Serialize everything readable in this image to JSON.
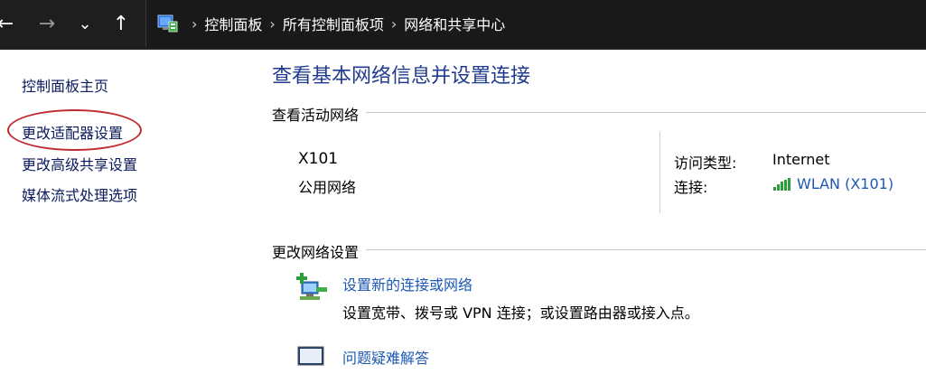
{
  "nav": {
    "back_glyph": "←",
    "forward_glyph": "→",
    "recent_glyph": "⌄",
    "up_glyph": "↑"
  },
  "address": {
    "icon": "control-panel-icon",
    "crumbs": [
      "控制面板",
      "所有控制面板项",
      "网络和共享中心"
    ],
    "separator": "›"
  },
  "sidebar": {
    "items": [
      "控制面板主页",
      "更改适配器设置",
      "更改高级共享设置",
      "媒体流式处理选项"
    ],
    "highlight_color": "#c22a30"
  },
  "main": {
    "title": "查看基本网络信息并设置连接",
    "active_section": "查看活动网络",
    "network": {
      "name": "X101",
      "type": "公用网络",
      "access_label": "访问类型:",
      "access_value": "Internet",
      "connection_label": "连接:",
      "connection_value": "WLAN (X101)",
      "connection_icon": "wifi-signal-icon"
    },
    "change_section": "更改网络设置",
    "tasks": [
      {
        "icon": "new-connection-icon",
        "title": "设置新的连接或网络",
        "desc": "设置宽带、拨号或 VPN 连接；或设置路由器或接入点。"
      },
      {
        "icon": "troubleshoot-icon",
        "title": "问题疑难解答",
        "desc": ""
      }
    ]
  },
  "colors": {
    "title_blue": "#1f3b8f",
    "link_blue": "#1d58b4",
    "topbar_bg": "#1e1e1e"
  }
}
